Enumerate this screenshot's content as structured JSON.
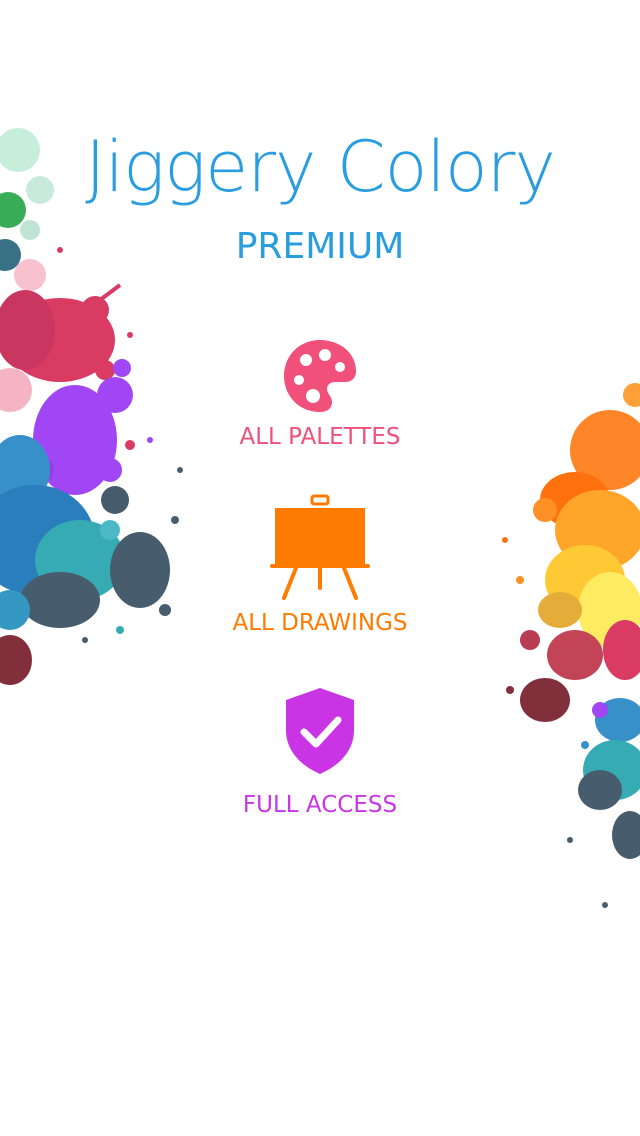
{
  "app": {
    "title": "Jiggery Colory",
    "subtitle": "PREMIUM"
  },
  "features": [
    {
      "label": "ALL PALETTES",
      "icon": "palette-icon",
      "color": "#F0507A"
    },
    {
      "label": "ALL DRAWINGS",
      "icon": "easel-icon",
      "color": "#FF7A00"
    },
    {
      "label": "FULL ACCESS",
      "icon": "shield-check-icon",
      "color": "#C935E5"
    }
  ],
  "colors": {
    "title": "#2A9DE0",
    "subtitle": "#2A9DE0",
    "background": "#FFFFFF"
  }
}
